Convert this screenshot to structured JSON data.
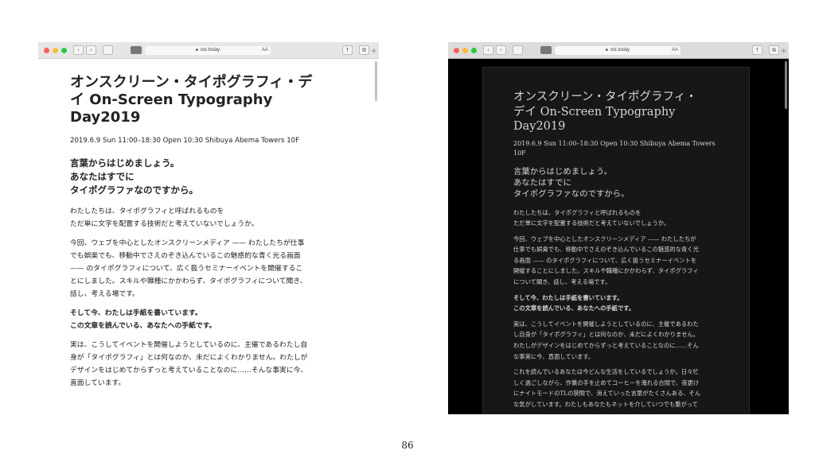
{
  "colors": {
    "close": "#ff5f57",
    "minimize": "#febc2e",
    "maximize": "#28c840"
  },
  "browser": {
    "url": "ost.today",
    "reader_text_size": "AA",
    "new_tab": "+"
  },
  "light": {
    "title_lines": [
      "オンスクリーン・タイポグラフィ・デ",
      "イ On-Screen Typography",
      "Day2019"
    ],
    "meta": "2019.6.9 Sun 11:00–18:30 Open 10:30 Shibuya Abema Towers 10F",
    "heading_lines": [
      "言葉からはじめましょう。",
      "あなたはすでに",
      "タイポグラファなのですから。"
    ],
    "paragraphs": [
      {
        "bold": false,
        "lines": [
          "わたしたちは、タイポグラフィと呼ばれるものを",
          "ただ単に文字を配置する技術だと考えていないでしょうか。"
        ]
      },
      {
        "bold": false,
        "lines": [
          "今回、ウェブを中心としたオンスクリーンメディア —— わたしたちが仕事",
          "でも娯楽でも、移動中でさえのぞき込んでいるこの魅惑的な青く光る画面",
          "—— のタイポグラフィについて、広く扱うセミナーイベントを開催するこ",
          "とにしました。スキルや職種にかかわらず、タイポグラフィについて聞き、",
          "話し、考える場です。"
        ]
      },
      {
        "bold": true,
        "lines": [
          "そして今、わたしは手紙を書いています。",
          "この文章を読んでいる、あなたへの手紙です。"
        ]
      },
      {
        "bold": false,
        "lines": [
          "実は、こうしてイベントを開催しようとしているのに、主催であるわたし自",
          "身が「タイポグラフィ」とは何なのか、未だによくわかりません。わたしが",
          "デザインをはじめてからずっと考えていることなのに……そんな事実に今、",
          "直面しています。"
        ]
      }
    ]
  },
  "dark": {
    "title_lines": [
      "オンスクリーン・タイポグラフィ・",
      "デイ On-Screen Typography",
      "Day2019"
    ],
    "meta": "2019.6.9 Sun 11:00–18:30 Open 10:30 Shibuya Abema Towers 10F",
    "heading_lines": [
      "言葉からはじめましょう。",
      "あなたはすでに",
      "タイポグラファなのですから。"
    ],
    "paragraphs": [
      {
        "bold": false,
        "lines": [
          "わたしたちは、タイポグラフィと呼ばれるものを",
          "ただ単に文字を配置する技術だと考えていないでしょうか。"
        ]
      },
      {
        "bold": false,
        "lines": [
          "今回、ウェブを中心としたオンスクリーンメディア —— わたしたちが",
          "仕事でも娯楽でも、移動中でさえのぞき込んでいるこの魅惑的な青く光",
          "る画面 —— のタイポグラフィについて、広く扱うセミナーイベントを",
          "開催することにしました。スキルや職種にかかわらず、タイポグラフィ",
          "について聞き、話し、考える場です。"
        ]
      },
      {
        "bold": true,
        "lines": [
          "そして今、わたしは手紙を書いています。",
          "この文章を読んでいる、あなたへの手紙です。"
        ]
      },
      {
        "bold": false,
        "lines": [
          "実は、こうしてイベントを開催しようとしているのに、主催であるわた",
          "し自身が「タイポグラフィ」とは何なのか、未だによくわかりません。",
          "わたしがデザインをはじめてからずっと考えていることなのに……そん",
          "な事実に今、直面しています。"
        ]
      },
      {
        "bold": false,
        "lines": [
          "これを読んでいるあなたは今どんな生活をしているでしょうか。日々忙",
          "しく過ごしながら、作業の手を止めてコーヒーを淹れる合間で、夜更け",
          "にナイトモードのTLの狭間で、消えていった言葉がたくさんある、そん",
          "な気がしています。わたしもあなたもネットを介していつでも繋がって"
        ]
      }
    ]
  },
  "page_number": "86"
}
